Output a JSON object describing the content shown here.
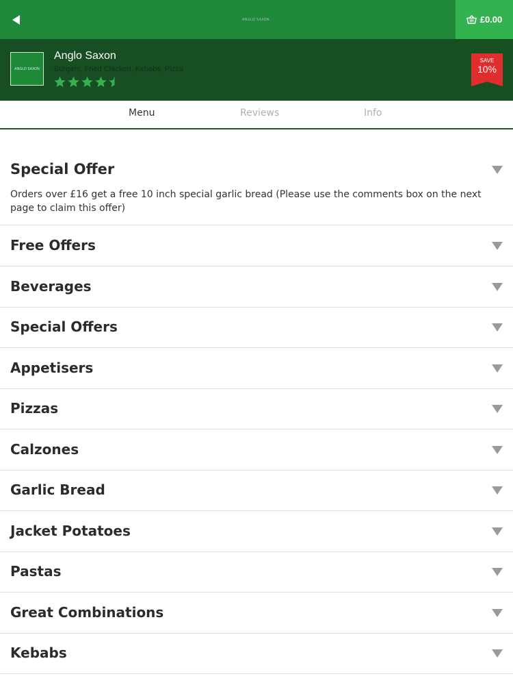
{
  "header": {
    "logo_text": "ANGLO SAXON",
    "basket_total": "£0.00"
  },
  "restaurant": {
    "logo_text": "ANGLO SAXON",
    "name": "Anglo Saxon",
    "cuisine": "Burgers, Fried Chicken, Kebabs, Pizza",
    "rating_stars": 4.5,
    "save_label": "SAVE",
    "save_value": "10%"
  },
  "tabs": {
    "menu": "Menu",
    "reviews": "Reviews",
    "info": "Info",
    "active": "Menu"
  },
  "menu": {
    "special_offer": {
      "title": "Special Offer",
      "description": "Orders over £16 get a free 10 inch special garlic bread (Please use the comments box on the next page to claim this offer)"
    },
    "categories": [
      "Free Offers",
      "Beverages",
      "Special Offers",
      "Appetisers",
      "Pizzas",
      "Calzones",
      "Garlic Bread",
      "Jacket Potatoes",
      "Pastas",
      "Great Combinations",
      "Kebabs"
    ]
  },
  "colors": {
    "top_bar": "#1f8a3a",
    "basket": "#33b34f",
    "restaurant_header": "#174f23",
    "star": "#35b14e",
    "save_badge": "#e02d2d",
    "divider": "#e0e0e0"
  },
  "icons": {
    "back": "back-arrow-icon",
    "basket": "basket-icon",
    "star": "star-icon",
    "expand": "chevron-down-icon"
  }
}
